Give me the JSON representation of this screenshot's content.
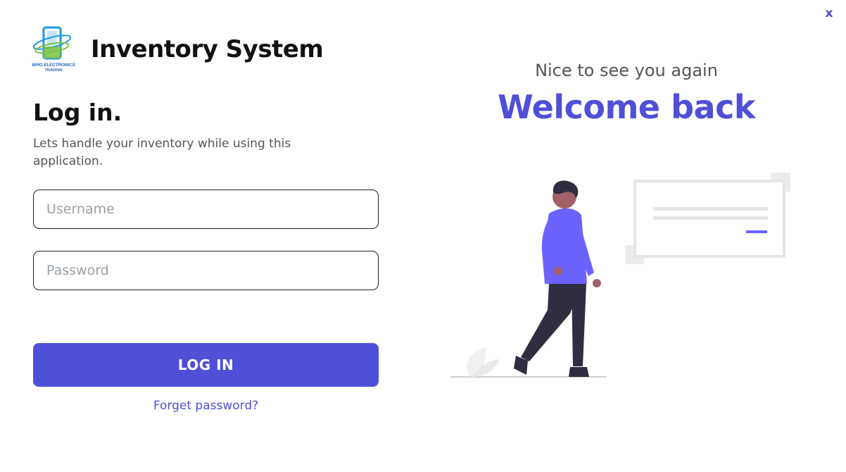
{
  "window": {
    "close_label": "x"
  },
  "brand": {
    "app_title": "Inventory System",
    "logo_text_line1": "WHO ELECTRONICS",
    "logo_text_line2": "TRADING",
    "colors": {
      "logo_blue": "#1e9be0",
      "logo_green": "#7cc242"
    }
  },
  "login": {
    "heading": "Log in.",
    "subtitle": "Lets handle your inventory while using this application.",
    "username_placeholder": "Username",
    "username_value": "",
    "password_placeholder": "Password",
    "password_value": "",
    "button_label": "LOG IN",
    "forgot_label": "Forget password?"
  },
  "hero": {
    "greeting": "Nice to see you again",
    "welcome": "Welcome back"
  },
  "colors": {
    "accent": "#4f4fd8",
    "text": "#111111",
    "muted": "#555555"
  }
}
